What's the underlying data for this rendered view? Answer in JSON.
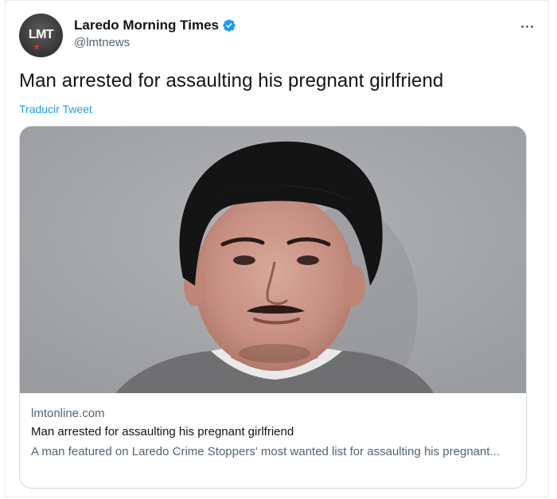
{
  "account": {
    "display_name": "Laredo Morning Times",
    "handle": "@lmtnews",
    "avatar_text": "LMT",
    "verified": true
  },
  "tweet": {
    "text": "Man arrested for assaulting his pregnant girlfriend",
    "translate_label": "Traducir Tweet"
  },
  "card": {
    "domain": "lmtonline.com",
    "title": "Man arrested for assaulting his pregnant girlfriend",
    "description": "A man featured on Laredo Crime Stoppers' most wanted list for assaulting his pregnant..."
  },
  "colors": {
    "accent": "#1d9bf0",
    "text_primary": "#0f1419",
    "text_secondary": "#536471"
  },
  "icons": {
    "verified": "verified-badge-icon",
    "more": "more-horizontal-icon"
  }
}
